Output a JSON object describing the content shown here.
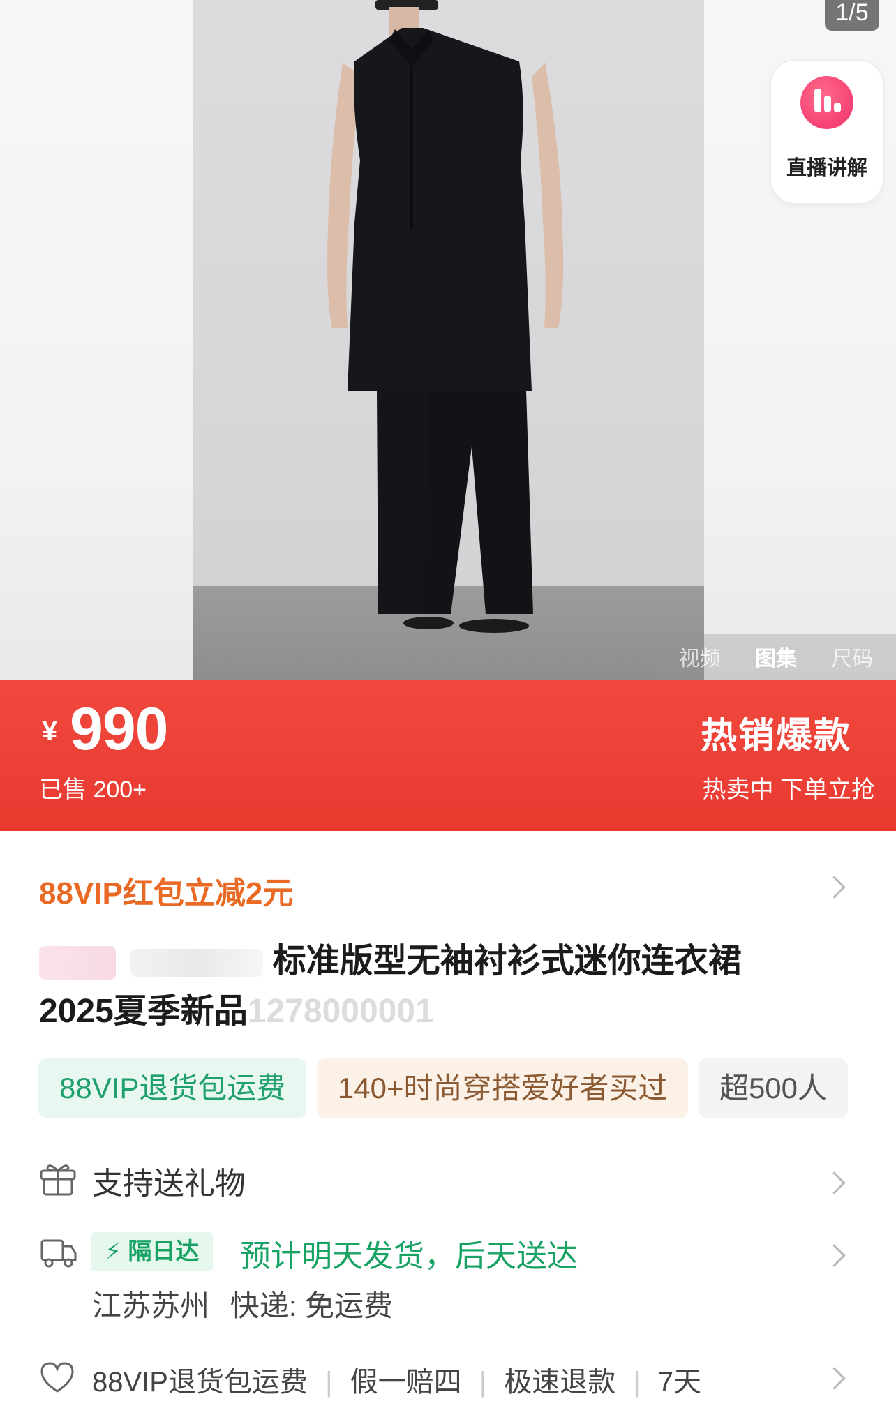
{
  "gallery": {
    "counter": "1/5",
    "live_label": "直播讲解",
    "media_tabs": [
      "视频",
      "图集",
      "尺码"
    ],
    "active_tab": "图集"
  },
  "price": {
    "currency": "¥",
    "amount": "990",
    "sold": "已售 200+",
    "hot_title": "热销爆款",
    "hot_sub": "热卖中 下单立抢"
  },
  "vip_promo": "88VIP红包立减2元",
  "product": {
    "title_line1": "标准版型无袖衬衫式迷你连衣裙",
    "title_line2_prefix": "2025夏季新品",
    "title_line2_code": "1278000001"
  },
  "tags": [
    "88VIP退货包运费",
    "140+时尚穿搭爱好者买过",
    "超500人"
  ],
  "gift": "支持送礼物",
  "shipping": {
    "badge": "隔日达",
    "estimate": "预计明天发货，后天送达",
    "origin": "江苏苏州",
    "method": "快递: 免运费"
  },
  "services": [
    "88VIP退货包运费",
    "假一赔四",
    "极速退款",
    "7天"
  ],
  "colors": {
    "price_band": "#ee4238",
    "vip_orange": "#e86a24",
    "express_green": "#18a364"
  }
}
